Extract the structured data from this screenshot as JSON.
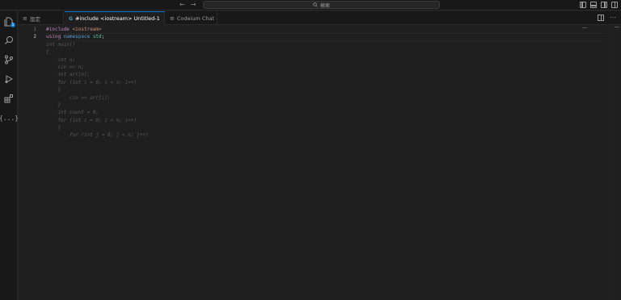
{
  "titlebar": {
    "search_label": "検索",
    "back_icon": "arrow-left-icon",
    "forward_icon": "arrow-right-icon"
  },
  "activity": {
    "explorer_badge": "1",
    "items": [
      "files-icon",
      "search-icon",
      "source-control-icon",
      "run-debug-icon",
      "extensions-icon",
      "braces-icon"
    ],
    "braces_text": "{...}"
  },
  "tabs": [
    {
      "icon": "settings-lines-icon",
      "icon_text": "≡",
      "label": "設定"
    },
    {
      "icon": "cpp-file-icon",
      "icon_text": "G",
      "label": "#include <iostream>  Untitled-1",
      "dirty": true
    },
    {
      "icon": "codeium-chat-icon",
      "icon_text": "≡",
      "label": "Codeium Chat"
    }
  ],
  "editor": {
    "line_numbers": [
      "1",
      "2"
    ],
    "current_line": 2,
    "code": [
      {
        "parts": [
          {
            "t": "#include ",
            "c": "tok-directive"
          },
          {
            "t": "<iostream>",
            "c": "tok-header"
          }
        ]
      },
      {
        "parts": [
          {
            "t": "using ",
            "c": "tok-kw"
          },
          {
            "t": "namespace ",
            "c": "tok-kw2"
          },
          {
            "t": "std",
            "c": "tok-ns"
          },
          {
            "t": ";",
            "c": "tok-punc"
          }
        ]
      }
    ],
    "ghost_lines": [
      "int main()",
      "{",
      "    int n;",
      "    cin >> n;",
      "    int arr[n];",
      "    for (int i = 0; i < n; i++)",
      "    {",
      "        cin >> arr[i];",
      "    }",
      "    int count = 0;",
      "    for (int i = 0; i < n; i++)",
      "    {",
      "        for (int j = 0; j < n; j++)"
    ]
  },
  "colors": {
    "accent": "#0078d4",
    "background": "#1f1f1f",
    "sidebar": "#181818"
  }
}
